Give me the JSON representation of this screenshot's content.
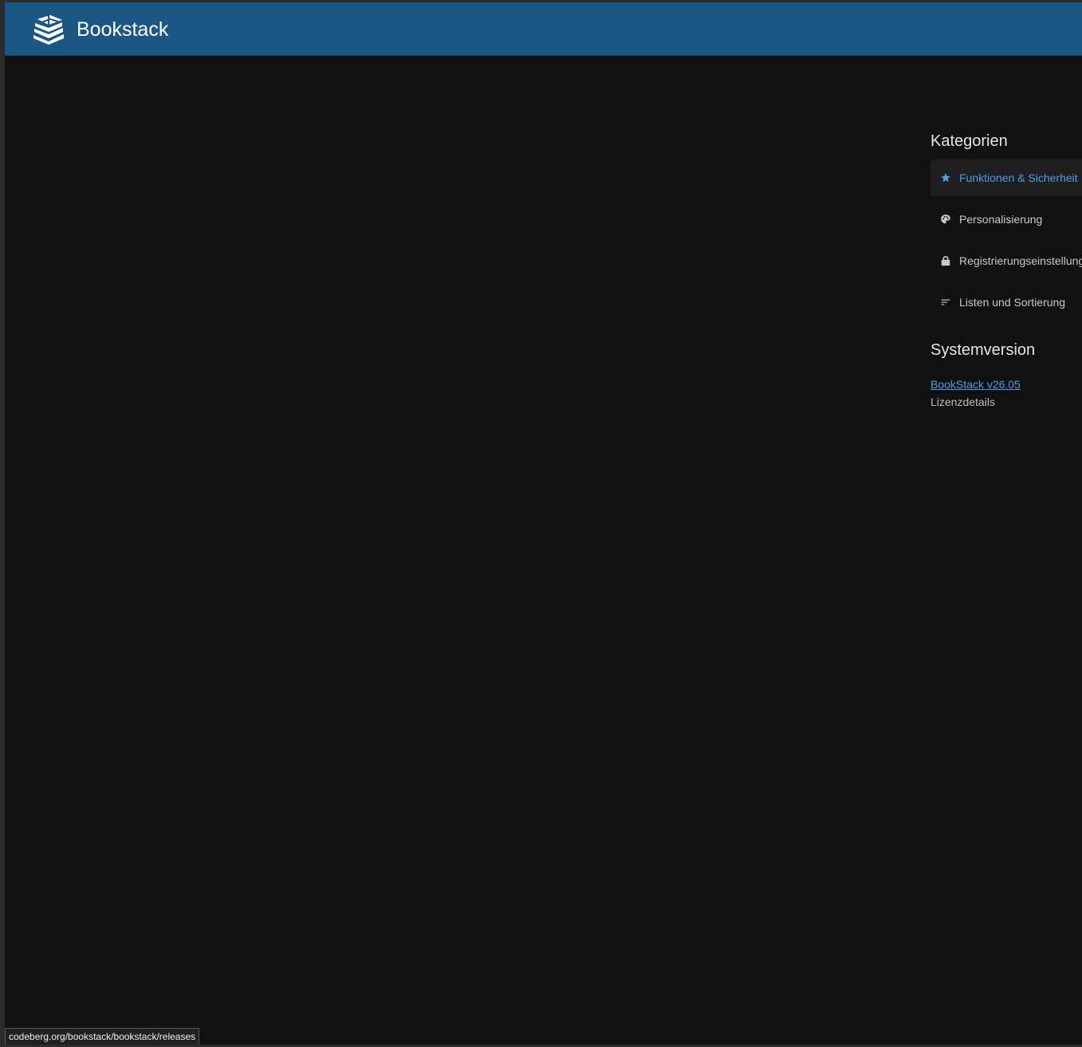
{
  "header": {
    "app_name": "Bookstack",
    "logo_icon": "bookstack-logo-icon",
    "background_color": "#1a5785"
  },
  "settings": {
    "categories_title": "Kategorien",
    "categories": [
      {
        "label": "Funktionen & Sicherheit",
        "icon": "star-icon",
        "active": true
      },
      {
        "label": "Personalisierung",
        "icon": "palette-icon",
        "active": false
      },
      {
        "label": "Registrierungseinstellung",
        "icon": "lock-icon",
        "active": false
      },
      {
        "label": "Listen und Sortierung",
        "icon": "sort-icon",
        "active": false
      }
    ],
    "system_version_title": "Systemversion",
    "version_link": "BookStack v26.05",
    "license_link": "Lizenzdetails"
  },
  "status_bar": {
    "url": "codeberg.org/bookstack/bookstack/releases"
  },
  "colors": {
    "page_background": "#111111",
    "active_link": "#4d9ee8",
    "text": "#c9c9c9"
  }
}
